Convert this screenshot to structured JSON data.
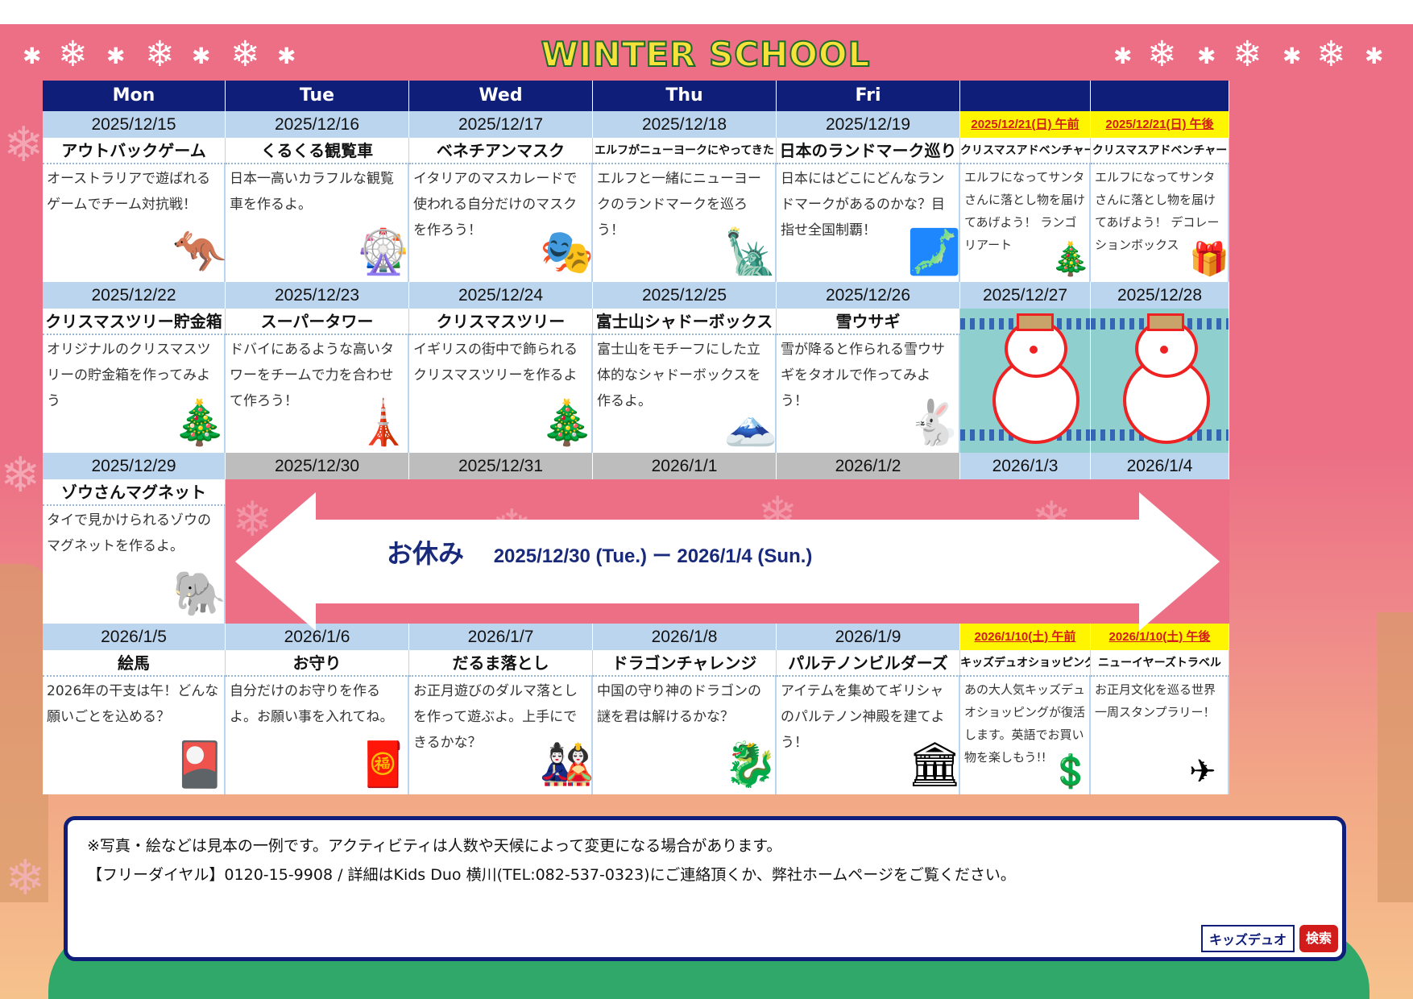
{
  "title": {
    "main": "WINTER SCHOOL",
    "year": "2025"
  },
  "days": [
    "Mon",
    "Tue",
    "Wed",
    "Thu",
    "Fri",
    "",
    ""
  ],
  "weeks": [
    {
      "dates": [
        "2025/12/15",
        "2025/12/16",
        "2025/12/17",
        "2025/12/18",
        "2025/12/19",
        "2025/12/21(日) 午前",
        "2025/12/21(日) 午後"
      ],
      "acts": [
        "アウトバックゲーム",
        "くるくる観覧車",
        "ベネチアンマスク",
        "エルフがニューヨークにやってきた",
        "日本のランドマーク巡り",
        "クリスマスアドベンチャー",
        "クリスマスアドベンチャー"
      ],
      "descs": [
        "オーストラリアで遊ばれるゲームでチーム対抗戦！",
        "日本一高いカラフルな観覧車を作るよ。",
        "イタリアのマスカレードで使われる自分だけのマスクを作ろう！",
        "エルフと一緒にニューヨークのランドマークを巡ろう！",
        "日本にはどこにどんなランドマークがあるのかな？目指せ全国制覇！",
        "エルフになってサンタさんに落とし物を届けてあげよう！ ランゴリアート",
        "エルフになってサンタさんに落とし物を届けてあげよう！ デコレーションボックス"
      ]
    },
    {
      "dates": [
        "2025/12/22",
        "2025/12/23",
        "2025/12/24",
        "2025/12/25",
        "2025/12/26",
        "2025/12/27",
        "2025/12/28"
      ],
      "acts": [
        "クリスマスツリー貯金箱",
        "スーパータワー",
        "クリスマスツリー",
        "富士山シャドーボックス",
        "雪ウサギ",
        "",
        ""
      ],
      "descs": [
        "オリジナルのクリスマスツリーの貯金箱を作ってみよう",
        "ドバイにあるような高いタワーをチームで力を合わせて作ろう！",
        "イギリスの街中で飾られるクリスマスツリーを作るよ",
        "富士山をモチーフにした立体的なシャドーボックスを作るよ。",
        "雪が降ると作られる雪ウサギをタオルで作ってみよう！",
        "",
        ""
      ]
    },
    {
      "dates": [
        "2025/12/29",
        "2025/12/30",
        "2025/12/31",
        "2026/1/1",
        "2026/1/2",
        "2026/1/3",
        "2026/1/4"
      ],
      "acts": [
        "ゾウさんマグネット"
      ],
      "descs": [
        "タイで見かけられるゾウのマグネットを作るよ。"
      ]
    },
    {
      "dates": [
        "2026/1/5",
        "2026/1/6",
        "2026/1/7",
        "2026/1/8",
        "2026/1/9",
        "2026/1/10(土) 午前",
        "2026/1/10(土) 午後"
      ],
      "acts": [
        "絵馬",
        "お守り",
        "だるま落とし",
        "ドラゴンチャレンジ",
        "パルテノンビルダーズ",
        "キッズデュオショッピング",
        "ニューイヤーズトラベル"
      ],
      "descs": [
        "2026年の干支は午！どんな願いごとを込める？",
        "自分だけのお守りを作るよ。お願い事を入れてね。",
        "お正月遊びのダルマ落としを作って遊ぶよ。上手にできるかな？",
        "中国の守り神のドラゴンの謎を君は解けるかな？",
        "アイテムを集めてギリシャのパルテノン神殿を建てよう！",
        "あの大人気キッズデュオショッピングが復活します。英語でお買い物を楽しもう!!",
        "お正月文化を巡る世界一周スタンプラリー！"
      ]
    }
  ],
  "holiday": {
    "label": "お休み",
    "range": "2025/12/30 (Tue.) ー 2026/1/4 (Sun.)"
  },
  "note": {
    "line1": "※写真・絵などは見本の一例です。アクティビティは人数や天候によって変更になる場合があります。",
    "line2": "【フリーダイヤル】0120-15-9908 / 詳細はKids Duo 横川(TEL:082-537-0323)にご連絡頂くか、弊社ホームページをご覧ください。",
    "search_text": "キッズデュオ",
    "search_button": "検索"
  },
  "colors": {
    "header": "#0f1e78",
    "date_bg": "#bcd5ee",
    "weekend_date": "#fff500",
    "background": "#ec6f85"
  }
}
